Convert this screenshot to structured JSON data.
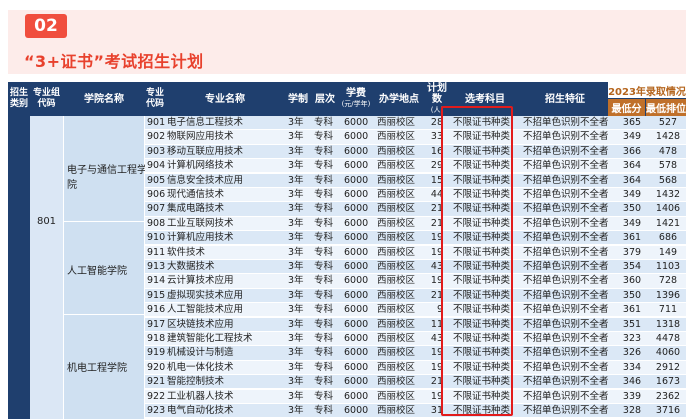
{
  "section": {
    "number": "02",
    "title": "“3+证书”考试招生计划"
  },
  "header": {
    "type": "招生类别",
    "zone_code": "专业组代码",
    "college": "学院名称",
    "major_code": "专业代码",
    "major": "专业名称",
    "years": "学制",
    "level": "层次",
    "fee": "学费",
    "fee_unit": "(元/学年)",
    "campus": "办学地点",
    "plan": "计划数",
    "plan_unit": "(人)",
    "subject": "选考科目",
    "feature": "招生特征",
    "year_title": "2023年录取情况",
    "min_score": "最低分",
    "min_rank": "最低排位"
  },
  "zone_code_value": "801",
  "colleges": [
    {
      "name": "电子与通信工程学院"
    },
    {
      "name": "人工智能学院"
    },
    {
      "name": "机电工程学院"
    }
  ],
  "rows": [
    {
      "code": "901",
      "major": "电子信息工程技术",
      "years": "3年",
      "level": "专科",
      "fee": "6000",
      "campus": "西丽校区",
      "plan": "28",
      "subject": "不限证书种类",
      "feature": "不招单色识别不全者",
      "score": "365",
      "rank": "527"
    },
    {
      "code": "902",
      "major": "物联网应用技术",
      "years": "3年",
      "level": "专科",
      "fee": "6000",
      "campus": "西丽校区",
      "plan": "33",
      "subject": "不限证书种类",
      "feature": "不招单色识别不全者",
      "score": "349",
      "rank": "1428"
    },
    {
      "code": "903",
      "major": "移动互联应用技术",
      "years": "3年",
      "level": "专科",
      "fee": "6000",
      "campus": "西丽校区",
      "plan": "16",
      "subject": "不限证书种类",
      "feature": "不招单色识别不全者",
      "score": "366",
      "rank": "478"
    },
    {
      "code": "904",
      "major": "计算机网络技术",
      "years": "3年",
      "level": "专科",
      "fee": "6000",
      "campus": "西丽校区",
      "plan": "29",
      "subject": "不限证书种类",
      "feature": "不招单色识别不全者",
      "score": "364",
      "rank": "578"
    },
    {
      "code": "905",
      "major": "信息安全技术应用",
      "years": "3年",
      "level": "专科",
      "fee": "6000",
      "campus": "西丽校区",
      "plan": "15",
      "subject": "不限证书种类",
      "feature": "不招单色识别不全者",
      "score": "364",
      "rank": "568"
    },
    {
      "code": "906",
      "major": "现代通信技术",
      "years": "3年",
      "level": "专科",
      "fee": "6000",
      "campus": "西丽校区",
      "plan": "44",
      "subject": "不限证书种类",
      "feature": "不招单色识别不全者",
      "score": "349",
      "rank": "1432"
    },
    {
      "code": "907",
      "major": "集成电路技术",
      "years": "3年",
      "level": "专科",
      "fee": "6000",
      "campus": "西丽校区",
      "plan": "21",
      "subject": "不限证书种类",
      "feature": "不招单色识别不全者",
      "score": "350",
      "rank": "1406"
    },
    {
      "code": "908",
      "major": "工业互联网技术",
      "years": "3年",
      "level": "专科",
      "fee": "6000",
      "campus": "西丽校区",
      "plan": "21",
      "subject": "不限证书种类",
      "feature": "不招单色识别不全者",
      "score": "349",
      "rank": "1421"
    },
    {
      "code": "910",
      "major": "计算机应用技术",
      "years": "3年",
      "level": "专科",
      "fee": "6000",
      "campus": "西丽校区",
      "plan": "19",
      "subject": "不限证书种类",
      "feature": "不招单色识别不全者",
      "score": "361",
      "rank": "686"
    },
    {
      "code": "911",
      "major": "软件技术",
      "years": "3年",
      "level": "专科",
      "fee": "6000",
      "campus": "西丽校区",
      "plan": "19",
      "subject": "不限证书种类",
      "feature": "不招单色识别不全者",
      "score": "379",
      "rank": "149"
    },
    {
      "code": "913",
      "major": "大数据技术",
      "years": "3年",
      "level": "专科",
      "fee": "6000",
      "campus": "西丽校区",
      "plan": "43",
      "subject": "不限证书种类",
      "feature": "不招单色识别不全者",
      "score": "354",
      "rank": "1103"
    },
    {
      "code": "914",
      "major": "云计算技术应用",
      "years": "3年",
      "level": "专科",
      "fee": "6000",
      "campus": "西丽校区",
      "plan": "19",
      "subject": "不限证书种类",
      "feature": "不招单色识别不全者",
      "score": "360",
      "rank": "728"
    },
    {
      "code": "915",
      "major": "虚拟现实技术应用",
      "years": "3年",
      "level": "专科",
      "fee": "6000",
      "campus": "西丽校区",
      "plan": "21",
      "subject": "不限证书种类",
      "feature": "不招单色识别不全者",
      "score": "350",
      "rank": "1396"
    },
    {
      "code": "916",
      "major": "人工智能技术应用",
      "years": "3年",
      "level": "专科",
      "fee": "6000",
      "campus": "西丽校区",
      "plan": "9",
      "subject": "不限证书种类",
      "feature": "不招单色识别不全者",
      "score": "361",
      "rank": "711"
    },
    {
      "code": "917",
      "major": "区块链技术应用",
      "years": "3年",
      "level": "专科",
      "fee": "6000",
      "campus": "西丽校区",
      "plan": "11",
      "subject": "不限证书种类",
      "feature": "不招单色识别不全者",
      "score": "351",
      "rank": "1318"
    },
    {
      "code": "918",
      "major": "建筑智能化工程技术",
      "years": "3年",
      "level": "专科",
      "fee": "6000",
      "campus": "西丽校区",
      "plan": "43",
      "subject": "不限证书种类",
      "feature": "不招单色识别不全者",
      "score": "323",
      "rank": "4478"
    },
    {
      "code": "919",
      "major": "机械设计与制造",
      "years": "3年",
      "level": "专科",
      "fee": "6000",
      "campus": "西丽校区",
      "plan": "19",
      "subject": "不限证书种类",
      "feature": "不招单色识别不全者",
      "score": "326",
      "rank": "4060"
    },
    {
      "code": "920",
      "major": "机电一体化技术",
      "years": "3年",
      "level": "专科",
      "fee": "6000",
      "campus": "西丽校区",
      "plan": "19",
      "subject": "不限证书种类",
      "feature": "不招单色识别不全者",
      "score": "334",
      "rank": "2912"
    },
    {
      "code": "921",
      "major": "智能控制技术",
      "years": "3年",
      "level": "专科",
      "fee": "6000",
      "campus": "西丽校区",
      "plan": "21",
      "subject": "不限证书种类",
      "feature": "不招单色识别不全者",
      "score": "346",
      "rank": "1673"
    },
    {
      "code": "922",
      "major": "工业机器人技术",
      "years": "3年",
      "level": "专科",
      "fee": "6000",
      "campus": "西丽校区",
      "plan": "19",
      "subject": "不限证书种类",
      "feature": "不招单色识别不全者",
      "score": "339",
      "rank": "2362"
    },
    {
      "code": "923",
      "major": "电气自动化技术",
      "years": "3年",
      "level": "专科",
      "fee": "6000",
      "campus": "西丽校区",
      "plan": "31",
      "subject": "不限证书种类",
      "feature": "不招单色识别不全者",
      "score": "328",
      "rank": "3716"
    }
  ],
  "colors": {
    "header_bg": "#1f3f6e",
    "accent": "#e8412d",
    "badge": "#f04e3e",
    "highlight_box": "#e21b1b",
    "year_header": "#c0702a"
  }
}
